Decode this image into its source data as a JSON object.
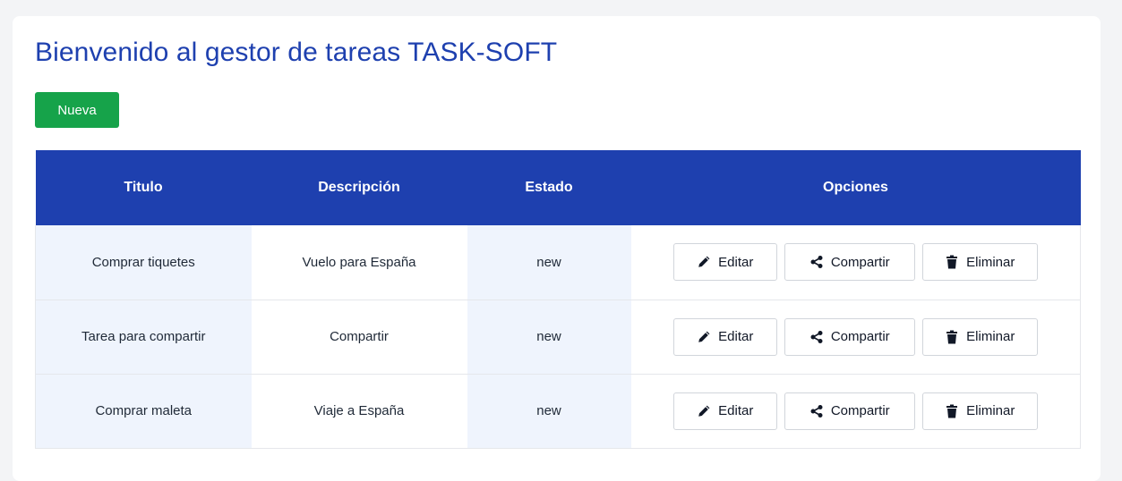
{
  "header": {
    "title": "Bienvenido al gestor de tareas TASK-SOFT",
    "new_button_label": "Nueva"
  },
  "table": {
    "columns": [
      "Titulo",
      "Descripción",
      "Estado",
      "Opciones"
    ],
    "rows": [
      {
        "title": "Comprar tiquetes",
        "description": "Vuelo para España",
        "state": "new"
      },
      {
        "title": "Tarea para compartir",
        "description": "Compartir",
        "state": "new"
      },
      {
        "title": "Comprar maleta",
        "description": "Viaje a España",
        "state": "new"
      }
    ],
    "actions": {
      "edit_label": "Editar",
      "share_label": "Compartir",
      "delete_label": "Eliminar"
    }
  },
  "icons": {
    "edit": "pencil-icon",
    "share": "share-icon",
    "delete": "trash-icon"
  },
  "colors": {
    "primary": "#1e40af",
    "success": "#16a34a",
    "row_alt": "#eff4fd"
  }
}
